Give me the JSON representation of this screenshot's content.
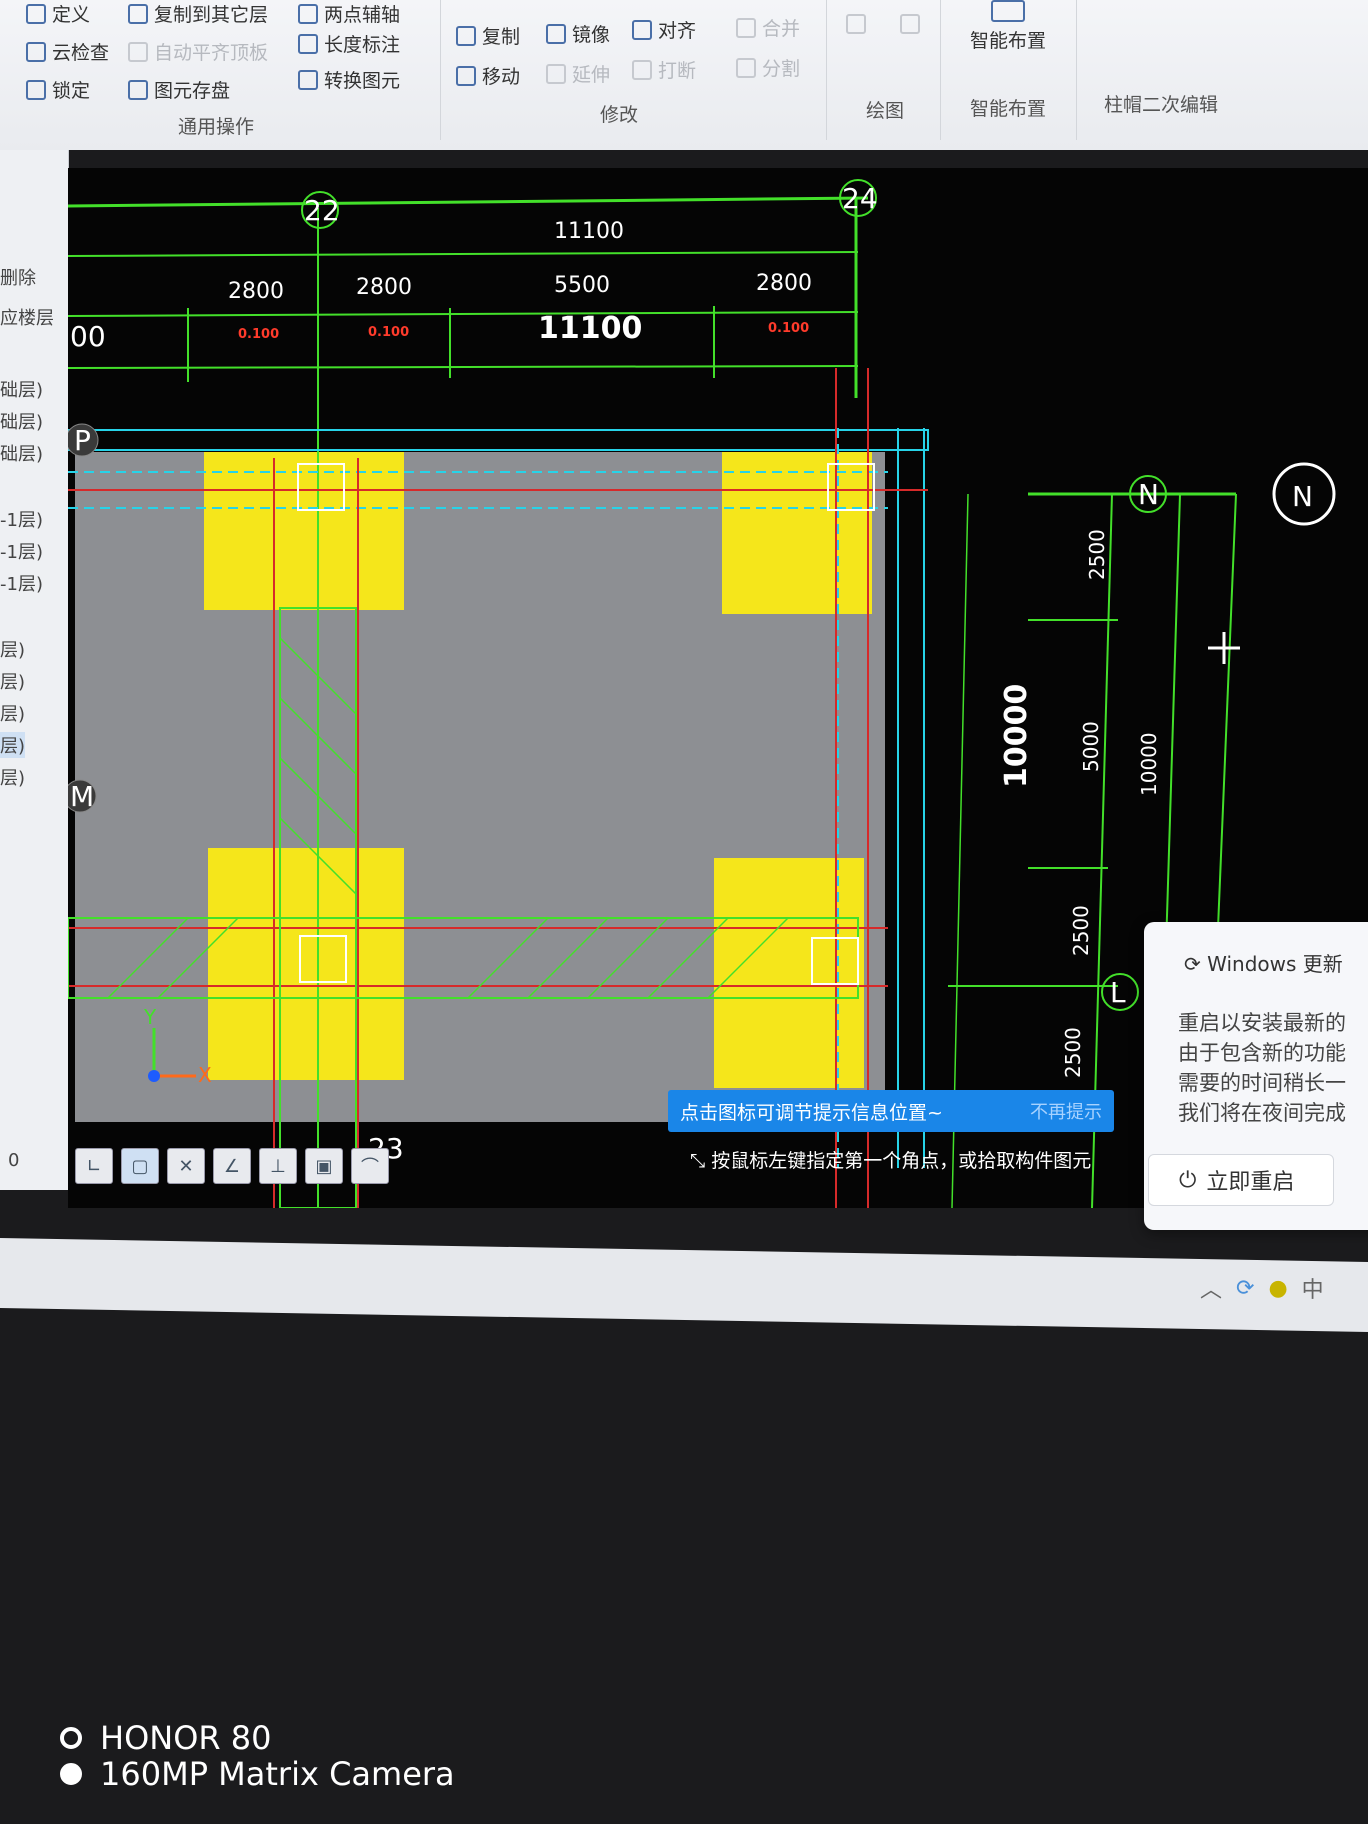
{
  "ribbon": {
    "row1": [
      {
        "label": "定义",
        "disabled": false
      },
      {
        "label": "复制到其它层",
        "disabled": false
      },
      {
        "label": "两点辅轴",
        "disabled": false
      }
    ],
    "row2": [
      {
        "label": "云检查",
        "disabled": false
      },
      {
        "label": "自动平齐顶板",
        "disabled": true
      },
      {
        "label": "长度标注",
        "disabled": false
      }
    ],
    "row3": [
      {
        "label": "锁定",
        "disabled": false
      },
      {
        "label": "图元存盘",
        "disabled": false
      },
      {
        "label": "转换图元",
        "disabled": false
      }
    ],
    "modify": {
      "copy": "复制",
      "mirror": "镜像",
      "align": "对齐",
      "merge": "合并",
      "move": "移动",
      "extend": "延伸",
      "break": "打断",
      "split": "分割"
    },
    "groups": {
      "common": "通用操作",
      "modify": "修改",
      "draw": "绘图",
      "smart": "智能布置",
      "cap_edit": "柱帽二次编辑"
    },
    "smart_button": "智能布置"
  },
  "left_panel": {
    "items": [
      "删除",
      "应楼层",
      "00",
      "础层)",
      "础层)",
      "础层)",
      "-1层)",
      "-1层)",
      "-1层)",
      "层)",
      "层)",
      "层)",
      "层)",
      "层)"
    ]
  },
  "cad": {
    "top_dim_total": "11100",
    "top_dims": [
      "2800",
      "2800",
      "5500",
      "2800"
    ],
    "top_dim_mid_label": "11100",
    "left_number": "00",
    "red_tag": "0.100",
    "axes_top": [
      "22",
      "24"
    ],
    "axis_bottom": "23",
    "axes_side": [
      "N",
      "N",
      "L",
      "P",
      "M"
    ],
    "right_dims": [
      "2500",
      "5000",
      "2500",
      "2500"
    ],
    "right_total": "10000",
    "right_total_small": "10000",
    "ucs_x": "X",
    "ucs_y": "Y",
    "bottom_left_zero": "0"
  },
  "hint": {
    "text": "点击图标可调节提示信息位置~",
    "dismiss": "不再提示"
  },
  "status_prompt": "按鼠标左键指定第一个角点，或拾取构件图元",
  "toast": {
    "title": "Windows 更新",
    "lines": [
      "重启以安装最新的",
      "由于包含新的功能",
      "需要的时间稍长一",
      "我们将在夜间完成"
    ],
    "restart": "立即重启"
  },
  "tray": {
    "ime": "中"
  },
  "watermark": {
    "brand": "HONOR 80",
    "camera": "160MP Matrix Camera"
  },
  "colors": {
    "pad": "#f5e61b",
    "grid": "#43e02a",
    "cyan": "#27d3e8",
    "red": "#d62a2a"
  }
}
